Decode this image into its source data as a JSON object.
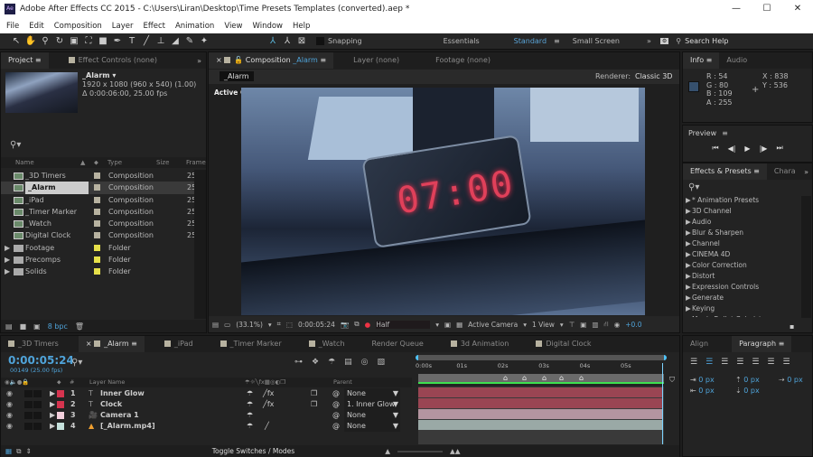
{
  "window": {
    "app_icon": "Ae",
    "title": "Adobe After Effects CC 2015 - C:\\Users\\Liran\\Desktop\\Time Presets Templates (converted).aep *",
    "min": "—",
    "max": "☐",
    "close": "✕"
  },
  "menu": [
    "File",
    "Edit",
    "Composition",
    "Layer",
    "Effect",
    "Animation",
    "View",
    "Window",
    "Help"
  ],
  "toolbar": {
    "snapping": "Snapping",
    "workspaces": [
      "Essentials",
      "Standard",
      "Small Screen"
    ],
    "search_help": "Search Help",
    "more": "»"
  },
  "project": {
    "tab": "Project",
    "effect_controls": "Effect Controls (none)",
    "item_name": "_Alarm ▾",
    "item_res": "1920 x 1080  (960 x 540) (1.00)",
    "item_dur": "Δ 0:00:06:00, 25.00 fps",
    "columns": [
      "Name",
      "Type",
      "Size",
      "Frame"
    ],
    "items": [
      {
        "name": "_3D Timers",
        "type": "Composition",
        "frame": "25",
        "color": "#b7b2a0",
        "kind": "comp"
      },
      {
        "name": "_Alarm",
        "type": "Composition",
        "frame": "25",
        "color": "#b7b2a0",
        "kind": "comp"
      },
      {
        "name": "_iPad",
        "type": "Composition",
        "frame": "25",
        "color": "#b7b2a0",
        "kind": "comp"
      },
      {
        "name": "_Timer Marker",
        "type": "Composition",
        "frame": "25",
        "color": "#b7b2a0",
        "kind": "comp"
      },
      {
        "name": "_Watch",
        "type": "Composition",
        "frame": "25",
        "color": "#b7b2a0",
        "kind": "comp"
      },
      {
        "name": "Digital Clock",
        "type": "Composition",
        "frame": "25",
        "color": "#b7b2a0",
        "kind": "comp"
      },
      {
        "name": "Footage",
        "type": "Folder",
        "frame": "",
        "color": "#e6e04a",
        "kind": "folder"
      },
      {
        "name": "Precomps",
        "type": "Folder",
        "frame": "",
        "color": "#e6e04a",
        "kind": "folder"
      },
      {
        "name": "Solids",
        "type": "Folder",
        "frame": "",
        "color": "#e6e04a",
        "kind": "folder"
      }
    ],
    "bpc": "8 bpc"
  },
  "composition": {
    "tab": "Composition",
    "comp_name": "_Alarm",
    "layer_tab": "Layer (none)",
    "footage_tab": "Footage (none)",
    "sub_tab": "_Alarm",
    "renderer_label": "Renderer:",
    "renderer": "Classic 3D",
    "view_label": "Active Camera",
    "clock_text": "07:00",
    "footer": {
      "zoom": "(33.1%)",
      "timecode": "0:00:05:24",
      "resolution": "Half",
      "camera": "Active Camera",
      "views": "1 View",
      "exposure": "+0.0"
    }
  },
  "info": {
    "tab": "Info",
    "audio_tab": "Audio",
    "swatch": "#36506d",
    "r": "R : 54",
    "g": "G : 80",
    "b": "B : 109",
    "a": "A : 255",
    "x": "X : 838",
    "y": "Y : 536"
  },
  "preview": {
    "tab": "Preview",
    "buttons": [
      "⏮",
      "◀|",
      "▶",
      "|▶",
      "⏭"
    ]
  },
  "effects": {
    "tab": "Effects & Presets",
    "char_tab": "Chara",
    "items": [
      "* Animation Presets",
      "3D Channel",
      "Audio",
      "Blur & Sharpen",
      "Channel",
      "CINEMA 4D",
      "Color Correction",
      "Distort",
      "Expression Controls",
      "Generate",
      "Keying",
      "Magic Bullet Colorista"
    ]
  },
  "timeline": {
    "tabs": [
      "_3D Timers",
      "_Alarm",
      "_iPad",
      "_Timer Marker",
      "_Watch",
      "Render Queue",
      "3d Animation",
      "Digital Clock"
    ],
    "timecode": "0:00:05:24",
    "frame_info": "00149 (25.00 fps)",
    "headers": {
      "num": "#",
      "name": "Layer Name",
      "parent": "Parent"
    },
    "layers": [
      {
        "num": "1",
        "name": "Inner Glow",
        "type": "T",
        "color": "#d6344f",
        "parent": "None",
        "bar": "#9a4553"
      },
      {
        "num": "2",
        "name": "Clock",
        "type": "T",
        "color": "#d6344f",
        "parent": "1. Inner Glow",
        "bar": "#9a4553"
      },
      {
        "num": "3",
        "name": "Camera 1",
        "type": "cam",
        "color": "#f2cfdc",
        "parent": "None",
        "bar": "#b495a0"
      },
      {
        "num": "4",
        "name": "[_Alarm.mp4]",
        "type": "vid",
        "color": "#c6e2dd",
        "parent": "None",
        "bar": "#9aa9a6"
      }
    ],
    "ruler": [
      "0:00s",
      "01s",
      "02s",
      "03s",
      "04s",
      "05s"
    ],
    "toggle": "Toggle Switches / Modes"
  },
  "paragraph": {
    "align_tab": "Align",
    "tab": "Paragraph",
    "fields": [
      "0 px",
      "0 px",
      "0 px",
      "0 px",
      "0 px"
    ]
  }
}
